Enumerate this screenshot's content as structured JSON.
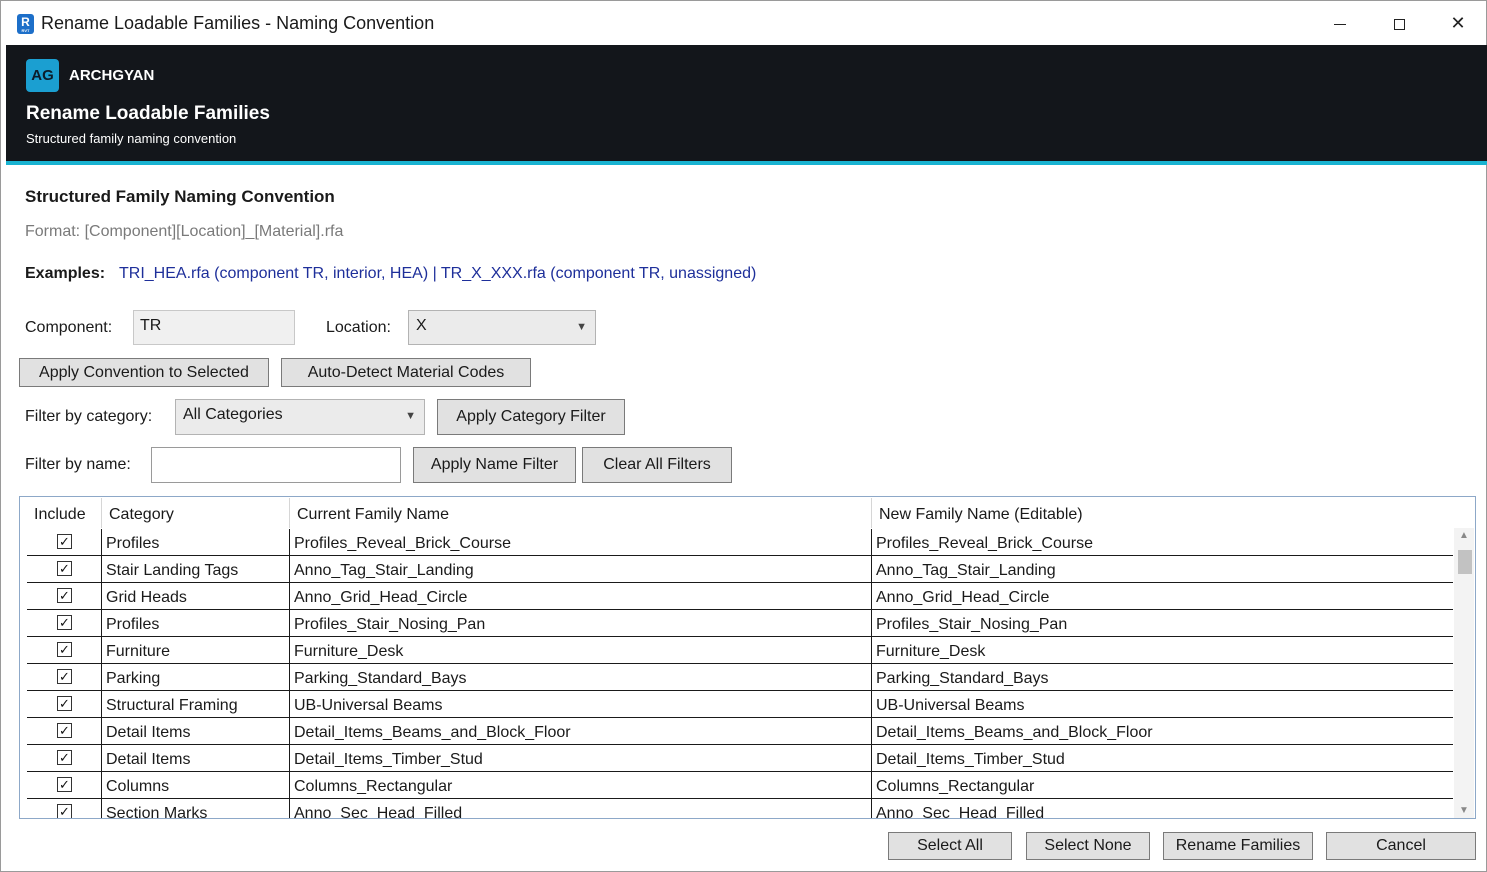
{
  "window": {
    "title": "Rename Loadable Families - Naming Convention"
  },
  "header": {
    "logo": "AG",
    "brand": "ARCHGYAN",
    "title": "Rename Loadable Families",
    "subtitle": "Structured family naming convention",
    "accent_color": "#19b3d1"
  },
  "convention": {
    "title": "Structured Family Naming Convention",
    "format": "Format: [Component][Location]_[Material].rfa",
    "examples_label": "Examples:",
    "examples_text": "TRI_HEA.rfa (component TR, interior, HEA) | TR_X_XXX.rfa (component TR, unassigned)"
  },
  "form": {
    "component_label": "Component:",
    "component_value": "TR",
    "location_label": "Location:",
    "location_value": "X",
    "apply_convention_btn": "Apply Convention to Selected",
    "auto_detect_btn": "Auto-Detect Material Codes",
    "filter_category_label": "Filter by category:",
    "filter_category_value": "All Categories",
    "apply_category_btn": "Apply Category Filter",
    "filter_name_label": "Filter by name:",
    "filter_name_value": "",
    "apply_name_btn": "Apply Name Filter",
    "clear_filters_btn": "Clear All Filters"
  },
  "grid": {
    "columns": [
      "Include",
      "Category",
      "Current Family Name",
      "New Family Name (Editable)"
    ],
    "rows": [
      {
        "include": "✓",
        "category": "Profiles",
        "current": "Profiles_Reveal_Brick_Course",
        "new": "Profiles_Reveal_Brick_Course"
      },
      {
        "include": "✓",
        "category": "Stair Landing Tags",
        "current": "Anno_Tag_Stair_Landing",
        "new": "Anno_Tag_Stair_Landing"
      },
      {
        "include": "✓",
        "category": "Grid Heads",
        "current": "Anno_Grid_Head_Circle",
        "new": "Anno_Grid_Head_Circle"
      },
      {
        "include": "✓",
        "category": "Profiles",
        "current": "Profiles_Stair_Nosing_Pan",
        "new": "Profiles_Stair_Nosing_Pan"
      },
      {
        "include": "✓",
        "category": "Furniture",
        "current": "Furniture_Desk",
        "new": "Furniture_Desk"
      },
      {
        "include": "✓",
        "category": "Parking",
        "current": "Parking_Standard_Bays",
        "new": "Parking_Standard_Bays"
      },
      {
        "include": "✓",
        "category": "Structural Framing",
        "current": "UB-Universal Beams",
        "new": "UB-Universal Beams"
      },
      {
        "include": "✓",
        "category": "Detail Items",
        "current": "Detail_Items_Beams_and_Block_Floor",
        "new": "Detail_Items_Beams_and_Block_Floor"
      },
      {
        "include": "✓",
        "category": "Detail Items",
        "current": "Detail_Items_Timber_Stud",
        "new": "Detail_Items_Timber_Stud"
      },
      {
        "include": "✓",
        "category": "Columns",
        "current": "Columns_Rectangular",
        "new": "Columns_Rectangular"
      },
      {
        "include": "✓",
        "category": "Section Marks",
        "current": "Anno_Sec_Head_Filled",
        "new": "Anno_Sec_Head_Filled"
      }
    ]
  },
  "footer": {
    "select_all": "Select All",
    "select_none": "Select None",
    "rename": "Rename Families",
    "cancel": "Cancel"
  }
}
